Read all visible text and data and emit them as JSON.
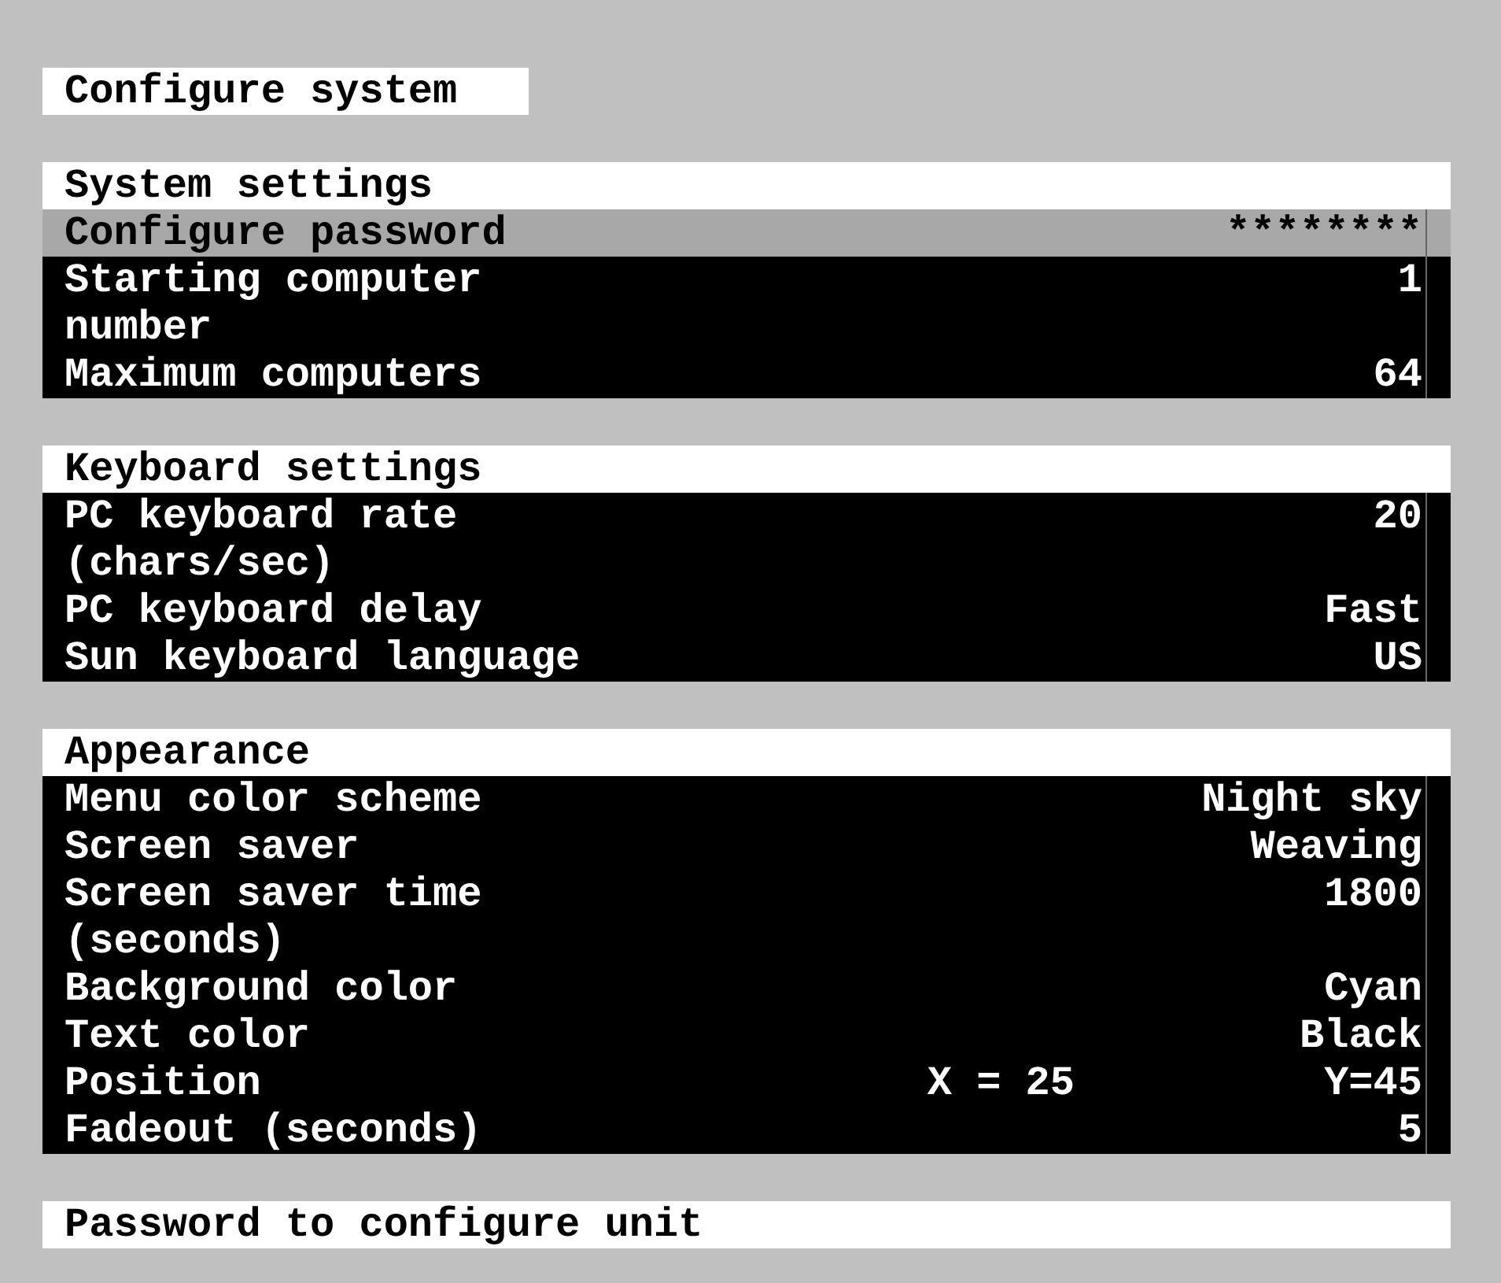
{
  "title": "Configure system",
  "sections": [
    {
      "heading": "System settings",
      "rows": [
        {
          "label": "Configure password",
          "value": "********",
          "selected": true
        },
        {
          "label": "Starting computer number",
          "value": "1",
          "selected": false
        },
        {
          "label": "Maximum computers",
          "value": "64",
          "selected": false
        }
      ]
    },
    {
      "heading": "Keyboard settings",
      "rows": [
        {
          "label": "PC keyboard rate (chars/sec)",
          "value": "20",
          "selected": false
        },
        {
          "label": "PC keyboard delay",
          "value": "Fast",
          "selected": false
        },
        {
          "label": "Sun keyboard language",
          "value": "US",
          "selected": false
        }
      ]
    },
    {
      "heading": "Appearance",
      "rows": [
        {
          "label": "Menu color scheme",
          "value": "Night sky",
          "selected": false
        },
        {
          "label": "Screen saver",
          "value": "Weaving",
          "selected": false
        },
        {
          "label": "Screen saver time (seconds)",
          "value": "1800",
          "selected": false
        },
        {
          "label": "Background color",
          "value": "Cyan",
          "selected": false
        },
        {
          "label": "Text color",
          "value": "Black",
          "selected": false
        },
        {
          "label": "Position",
          "mid_value": "X = 25",
          "value": "Y=45",
          "selected": false
        },
        {
          "label": "Fadeout (seconds)",
          "value": "5",
          "selected": false
        }
      ]
    }
  ],
  "help_text": "Password to configure unit"
}
